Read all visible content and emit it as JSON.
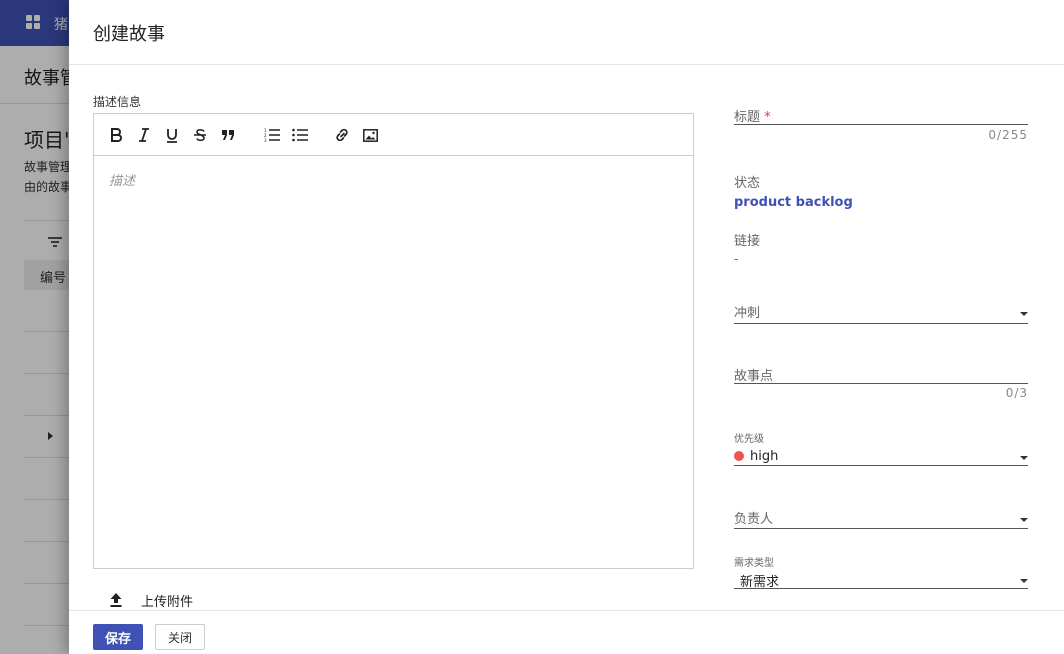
{
  "background": {
    "app_name": "猪",
    "header_title": "故事管",
    "project_title": "项目'",
    "description_line1": "故事管理",
    "description_line2": "由的故事",
    "table_header_id": "编号"
  },
  "dialog": {
    "title": "创建故事",
    "description_label": "描述信息",
    "editor_placeholder": "描述",
    "toolbar": [
      "bold-icon",
      "italic-icon",
      "underline-icon",
      "strikethrough-icon",
      "quote-icon",
      "ordered-list-icon",
      "bullet-list-icon",
      "link-icon",
      "image-icon"
    ],
    "upload_label": "上传附件",
    "save_label": "保存",
    "close_label": "关闭"
  },
  "form": {
    "title_label": "标题",
    "title_required_mark": "*",
    "title_counter": "0/255",
    "status_label": "状态",
    "status_value": "product backlog",
    "link_label": "链接",
    "link_value": "-",
    "sprint_label": "冲刺",
    "story_points_label": "故事点",
    "story_points_counter": "0/3",
    "priority_label": "优先级",
    "priority_value": "high",
    "priority_color": "#ef5350",
    "assignee_label": "负责人",
    "requirement_type_label": "需求类型",
    "requirement_type_value": "新需求"
  },
  "colors": {
    "primary": "#3f51b5",
    "link": "#3f51b5",
    "required": "#e53935"
  }
}
